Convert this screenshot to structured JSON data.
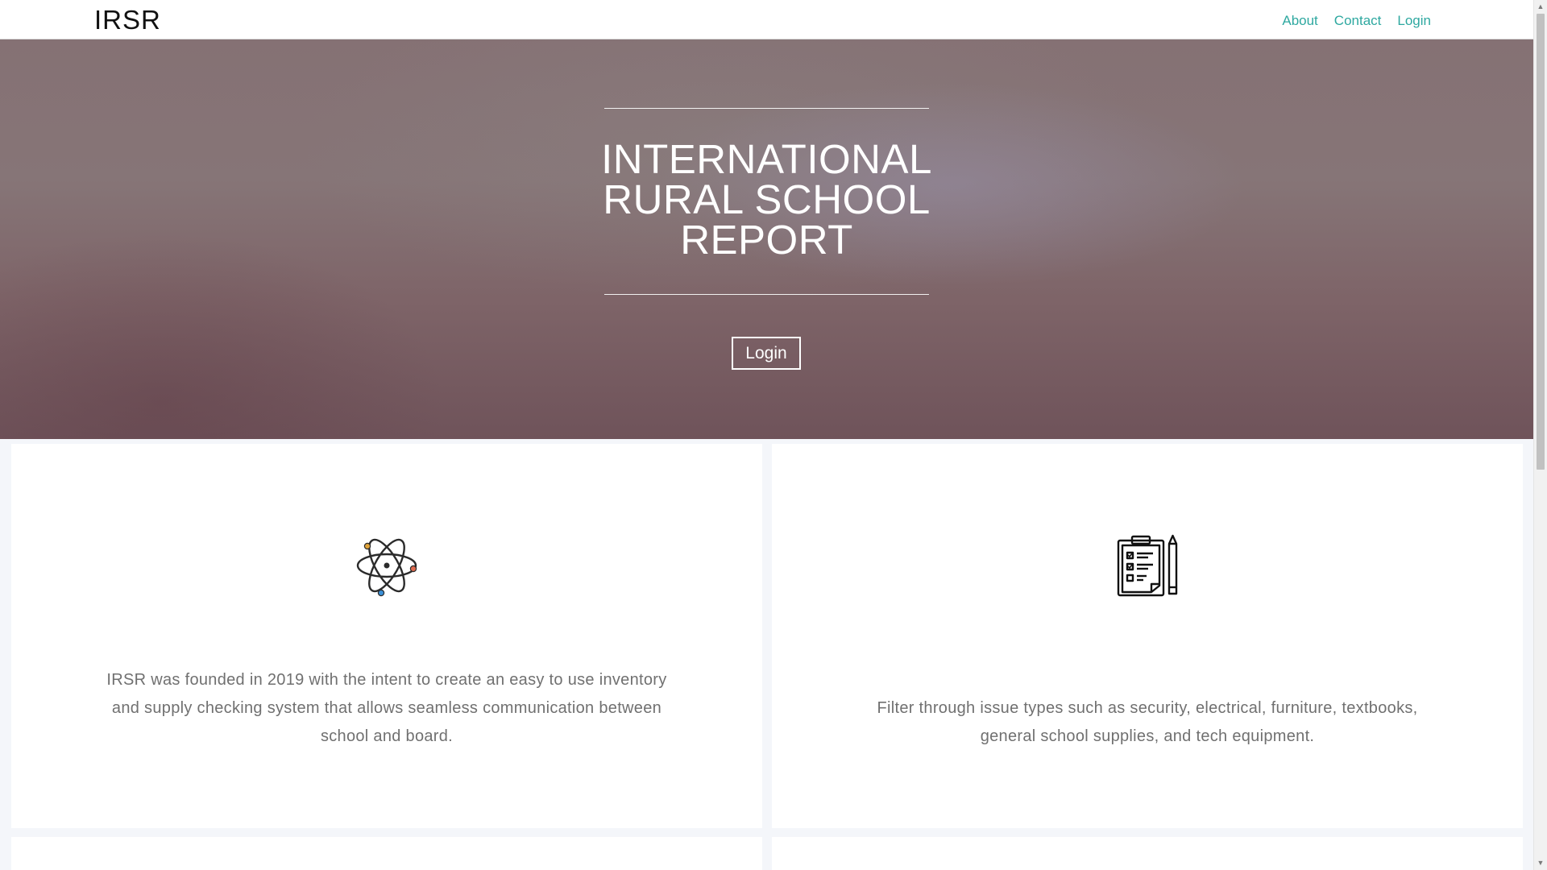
{
  "navbar": {
    "brand": "IRSR",
    "links": [
      "About",
      "Contact",
      "Login"
    ]
  },
  "hero": {
    "title": "INTERNATIONAL RURAL SCHOOL REPORT",
    "login_button": "Login"
  },
  "cards": [
    {
      "icon": "atom-icon",
      "text": "IRSR was founded in 2019 with the intent to create an easy to use inventory and supply checking system that allows seamless communication between school and board."
    },
    {
      "icon": "clipboard-checklist-icon",
      "text": "Filter through issue types such as security, electrical, furniture, textbooks, general school supplies, and tech equipment."
    }
  ],
  "colors": {
    "nav_link": "#2ea8a0",
    "body_text": "#707070",
    "hero_overlay": "#7e6468",
    "page_background": "#f4f6fa"
  }
}
